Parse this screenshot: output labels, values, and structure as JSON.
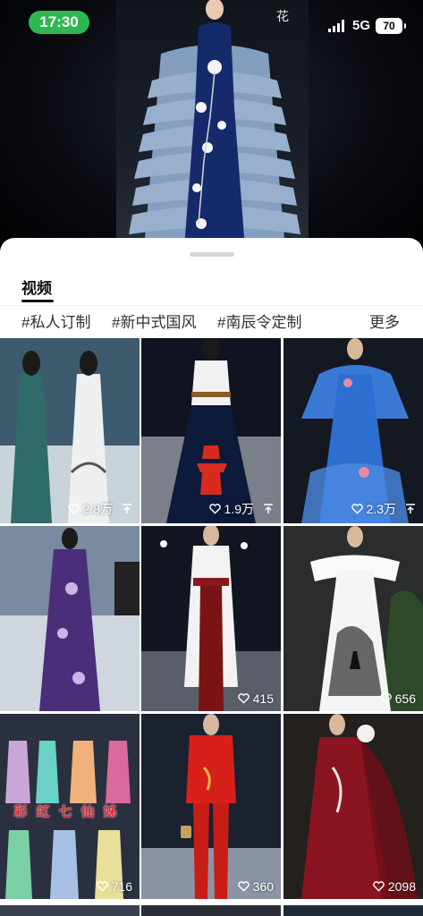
{
  "status": {
    "time": "17:30",
    "network": "5G",
    "battery": "70"
  },
  "hero": {
    "watermark": "花"
  },
  "sheet": {
    "tab_label": "视频",
    "hashtags": [
      "#私人订制",
      "#新中式国风",
      "#南辰令定制"
    ],
    "more_label": "更多"
  },
  "videos": [
    {
      "likes": "2.8万",
      "pinned": true,
      "theme": "teal-qipao"
    },
    {
      "likes": "1.9万",
      "pinned": true,
      "theme": "pagoda-skirt"
    },
    {
      "likes": "2.3万",
      "pinned": true,
      "theme": "blue-ruffle-gown"
    },
    {
      "likes": "",
      "pinned": false,
      "theme": "purple-peony-qipao"
    },
    {
      "likes": "415",
      "pinned": false,
      "theme": "white-red-coat"
    },
    {
      "likes": "656",
      "pinned": false,
      "theme": "ink-wash-gown"
    },
    {
      "likes": "716",
      "pinned": false,
      "theme": "rainbow-collage",
      "overlay": "彩虹七仙姊"
    },
    {
      "likes": "360",
      "pinned": false,
      "theme": "red-suit"
    },
    {
      "likes": "2098",
      "pinned": false,
      "theme": "burgundy-gown"
    }
  ],
  "colors": {
    "time_pill": "#2fb84f",
    "sheet_bg": "#ffffff"
  }
}
